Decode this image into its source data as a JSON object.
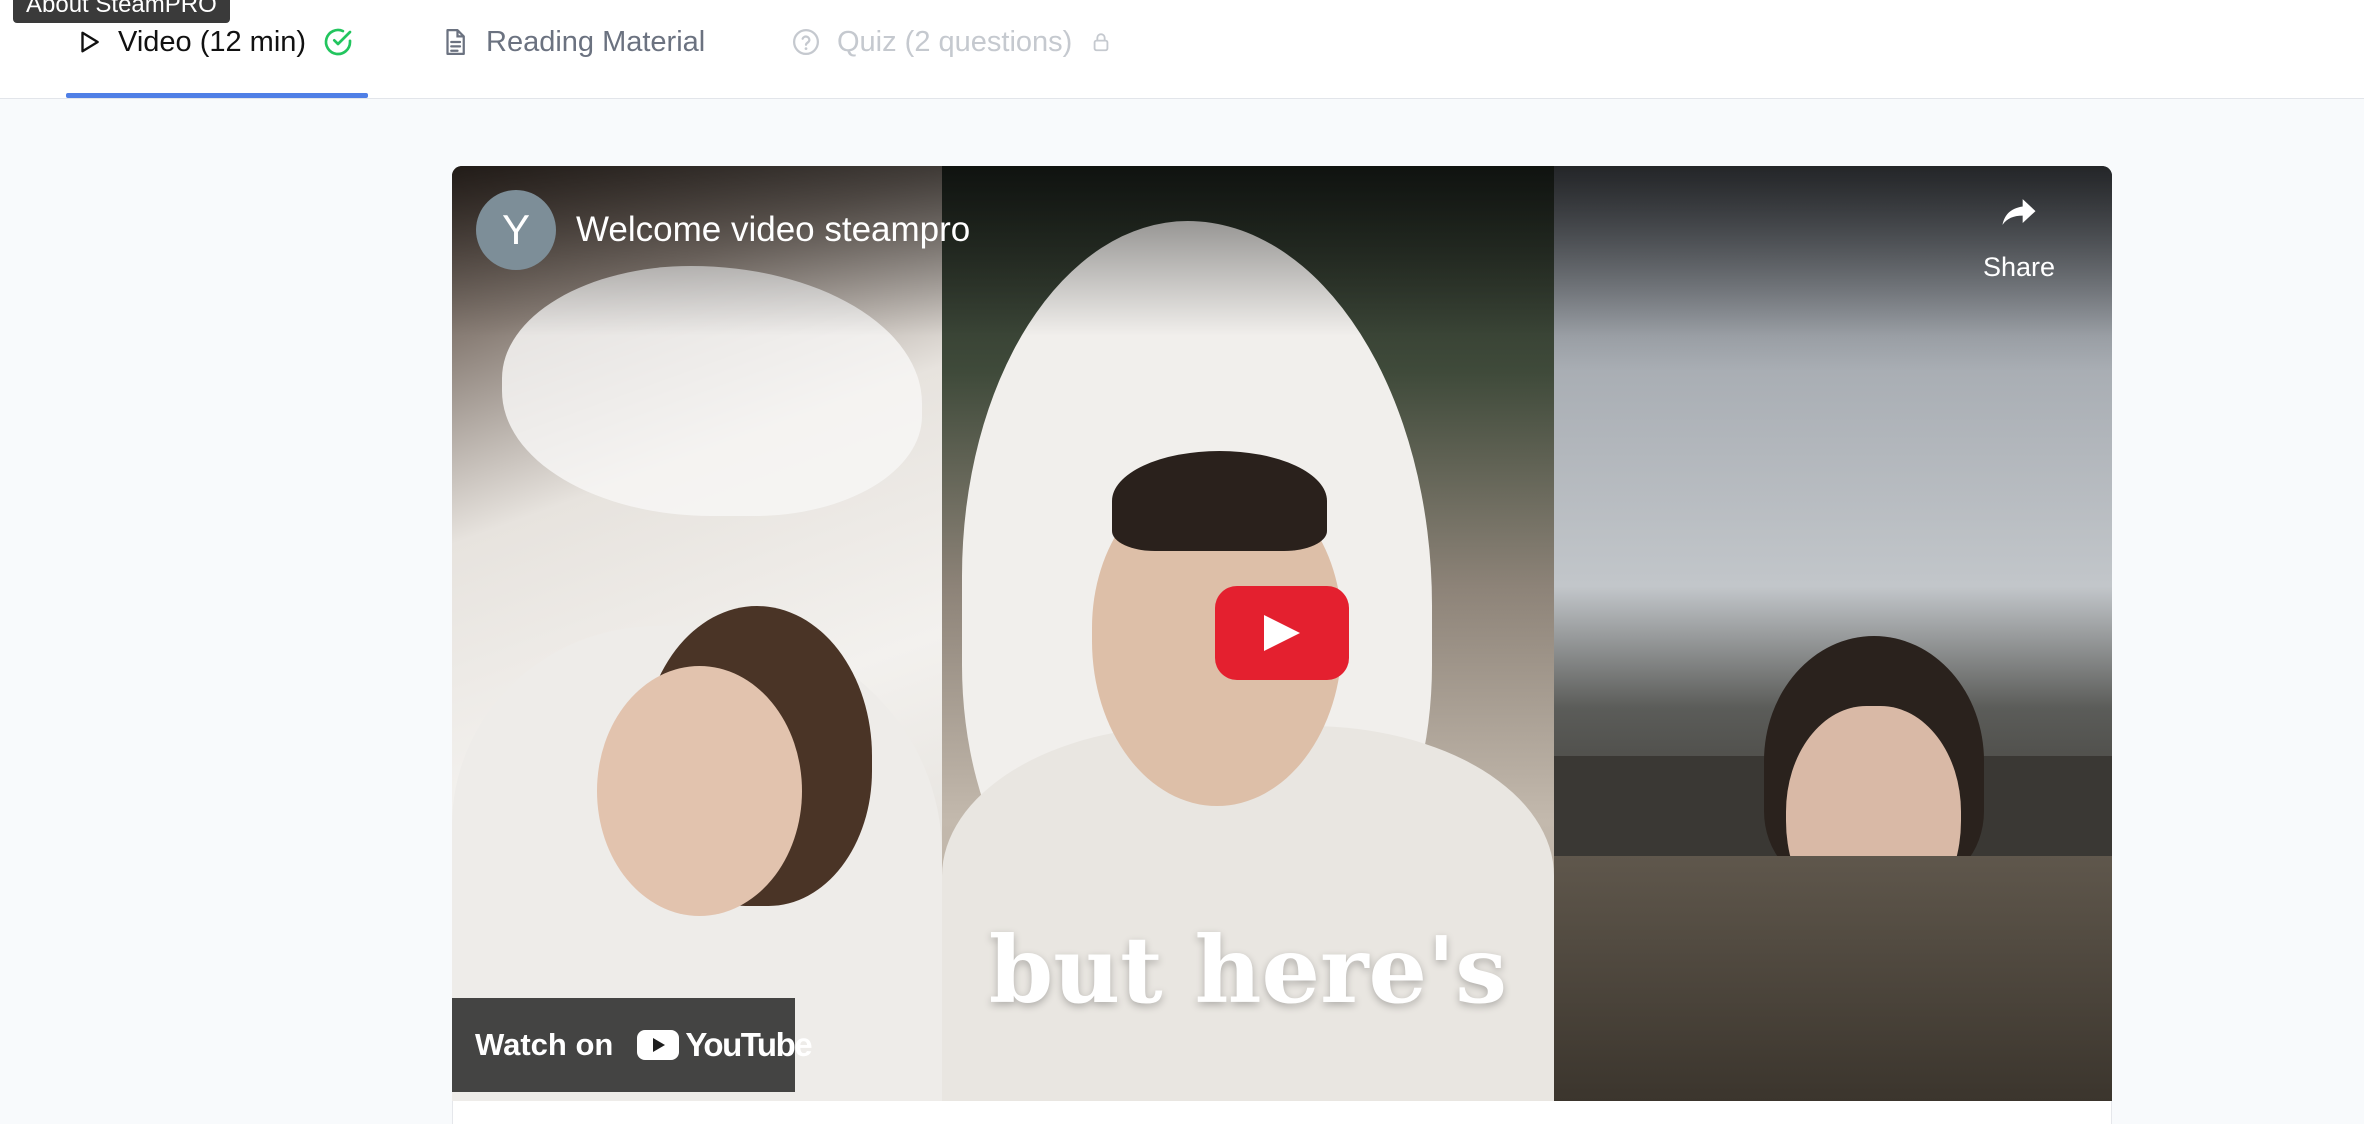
{
  "tooltip": {
    "text": "About SteamPRO"
  },
  "tabs": [
    {
      "label": "Video (12 min)",
      "icon": "play-icon",
      "status": "completed",
      "status_icon": "check-circle-icon",
      "active": true
    },
    {
      "label": "Reading Material",
      "icon": "document-icon",
      "active": false
    },
    {
      "label": "Quiz (2 questions)",
      "icon": "question-circle-icon",
      "locked": true,
      "status_icon": "lock-icon",
      "active": false
    }
  ],
  "video": {
    "channel_initial": "Y",
    "title": "Welcome video steampro",
    "share_label": "Share",
    "caption_overlay": "but here's",
    "watch_on_label": "Watch on",
    "platform_logo": "YouTube",
    "play_button_icon": "play-icon"
  },
  "colors": {
    "accent": "#4f7fe6",
    "success": "#22c55e",
    "youtube_red": "#e4202f",
    "muted": "#6b7280",
    "disabled": "#c5c9cf"
  }
}
